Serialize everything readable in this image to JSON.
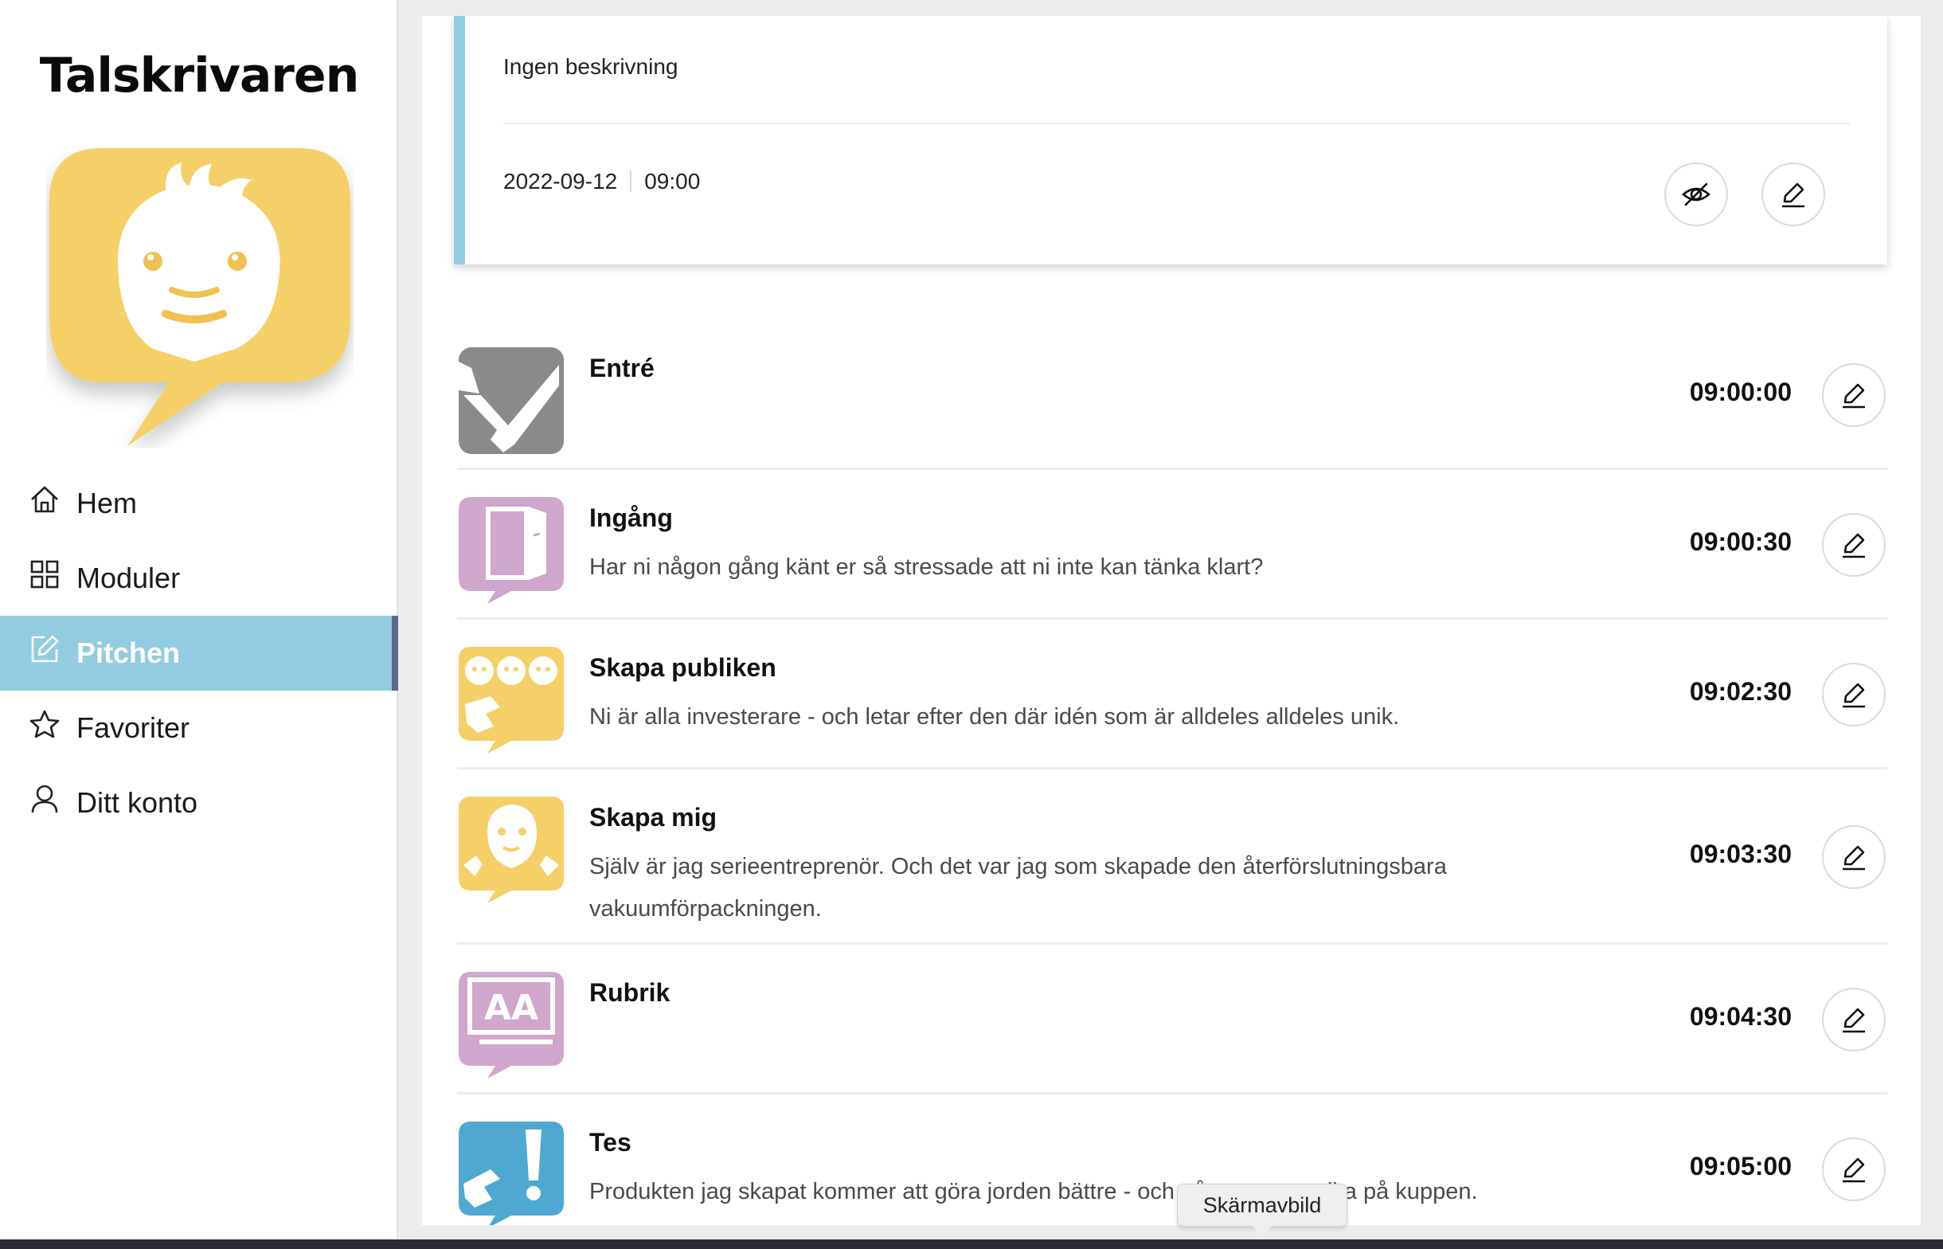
{
  "app": {
    "logo_text": "Talskrivaren"
  },
  "sidebar": {
    "items": [
      {
        "label": "Hem",
        "icon": "home-icon",
        "active": false
      },
      {
        "label": "Moduler",
        "icon": "grid-icon",
        "active": false
      },
      {
        "label": "Pitchen",
        "icon": "edit-square-icon",
        "active": true
      },
      {
        "label": "Favoriter",
        "icon": "star-icon",
        "active": false
      },
      {
        "label": "Ditt konto",
        "icon": "user-icon",
        "active": false
      }
    ]
  },
  "pitch": {
    "description": "Ingen beskrivning",
    "date": "2022-09-12",
    "time": "09:00",
    "accent_color": "#93cbe0"
  },
  "modules": [
    {
      "title": "Entré",
      "text": "",
      "time": "09:00:00",
      "icon": "entre-icon",
      "color": "#8a8a8a"
    },
    {
      "title": "Ingång",
      "text": "Har ni någon gång känt er så stressade att ni inte kan tänka klart?",
      "time": "09:00:30",
      "icon": "door-icon",
      "color": "#cfa6cc"
    },
    {
      "title": "Skapa publiken",
      "text": "Ni är alla investerare - och letar efter den där idén som är alldeles alldeles unik.",
      "time": "09:02:30",
      "icon": "audience-icon",
      "color": "#f5cf67"
    },
    {
      "title": "Skapa mig",
      "text": "Själv är jag serieentreprenör. Och det var jag som skapade den återförslutningsbara vakuumförpackningen.",
      "time": "09:03:30",
      "icon": "face-icon",
      "color": "#f5cf67"
    },
    {
      "title": "Rubrik",
      "text": "",
      "time": "09:04:30",
      "icon": "headline-icon",
      "color": "#cfa6cc"
    },
    {
      "title": "Tes",
      "text": "Produkten jag skapat kommer att göra jorden bättre - och några av oss rika på kuppen.",
      "time": "09:05:00",
      "icon": "exclamation-icon",
      "color": "#4ea8d2"
    }
  ],
  "tooltip": {
    "label": "Skärmavbild"
  },
  "colors": {
    "active_nav": "#93cbe0",
    "active_nav_bar": "#5b6a8c",
    "mascot": "#f5cf67"
  }
}
